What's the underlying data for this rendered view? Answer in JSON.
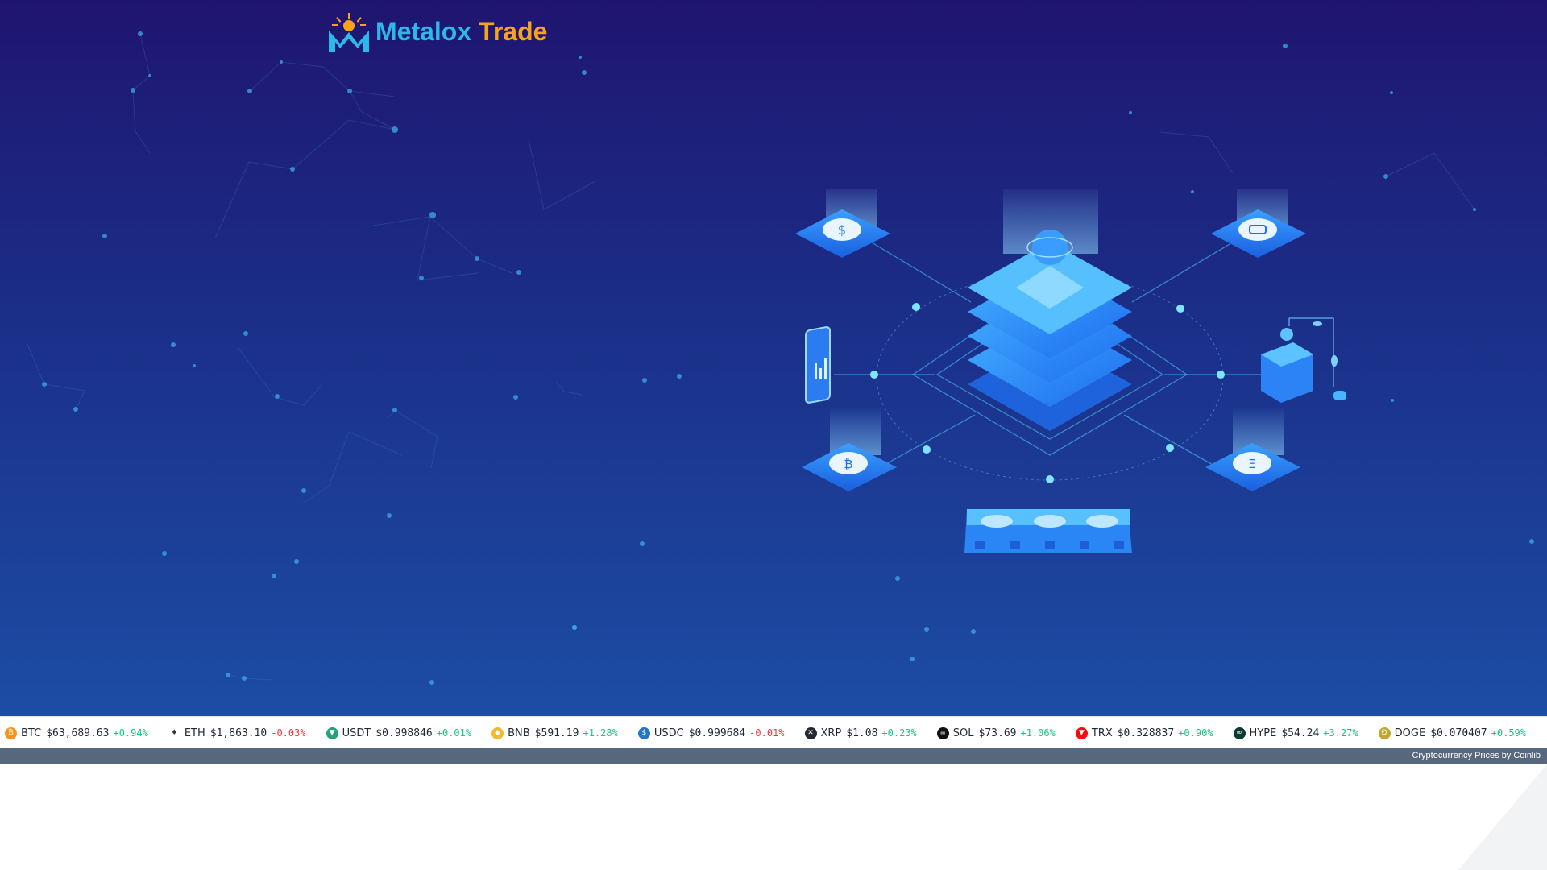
{
  "brand": {
    "name_part1": "Metalox",
    "name_part2": "Trade",
    "logo_icon": "sun-m-logo-icon"
  },
  "illustration": {
    "icon": "blockchain-server-isometric-illustration",
    "coin_labels": [
      "$",
      "₿",
      "Ξ"
    ]
  },
  "ticker": {
    "items": [
      {
        "symbol": "BTC",
        "price": "$63,689.63",
        "change": "+0.94%",
        "direction": "up",
        "icon_color": "#f7931a",
        "icon_glyph": "₿",
        "icon": "bitcoin-icon"
      },
      {
        "symbol": "ETH",
        "price": "$1,863.10",
        "change": "-0.03%",
        "direction": "down",
        "icon_color": "#ffffff",
        "icon_glyph": "♦",
        "icon": "ethereum-icon"
      },
      {
        "symbol": "USDT",
        "price": "$0.998846",
        "change": "+0.01%",
        "direction": "up",
        "icon_color": "#26a17b",
        "icon_glyph": "▼",
        "icon": "tether-icon"
      },
      {
        "symbol": "BNB",
        "price": "$591.19",
        "change": "+1.28%",
        "direction": "up",
        "icon_color": "#f3ba2f",
        "icon_glyph": "◆",
        "icon": "bnb-icon"
      },
      {
        "symbol": "USDC",
        "price": "$0.999684",
        "change": "-0.01%",
        "direction": "down",
        "icon_color": "#2775ca",
        "icon_glyph": "$",
        "icon": "usdc-icon"
      },
      {
        "symbol": "XRP",
        "price": "$1.08",
        "change": "+0.23%",
        "direction": "up",
        "icon_color": "#23292f",
        "icon_glyph": "✕",
        "icon": "xrp-icon"
      },
      {
        "symbol": "SOL",
        "price": "$73.69",
        "change": "+1.06%",
        "direction": "up",
        "icon_color": "#111111",
        "icon_glyph": "≡",
        "icon": "solana-icon"
      },
      {
        "symbol": "TRX",
        "price": "$0.328837",
        "change": "+0.90%",
        "direction": "up",
        "icon_color": "#ff060a",
        "icon_glyph": "▼",
        "icon": "tron-icon"
      },
      {
        "symbol": "HYPE",
        "price": "$54.24",
        "change": "+3.27%",
        "direction": "up",
        "icon_color": "#0c3b36",
        "icon_glyph": "∞",
        "icon": "hyperliquid-icon"
      },
      {
        "symbol": "DOGE",
        "price": "$0.070407",
        "change": "+0.59%",
        "direction": "up",
        "icon_color": "#c2a633",
        "icon_glyph": "Ð",
        "icon": "dogecoin-icon"
      }
    ],
    "credit": "Cryptocurrency Prices by Coinlib"
  },
  "colors": {
    "accent_blue": "#2eb8ea",
    "accent_orange": "#f6a41b",
    "positive": "#16c784",
    "negative": "#ea3943"
  }
}
